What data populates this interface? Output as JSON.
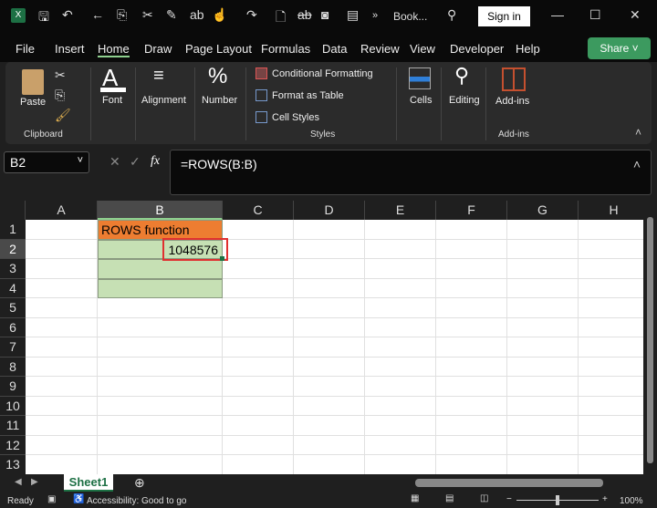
{
  "title": {
    "doc": "Book...",
    "sign_in": "Sign in",
    "more": "»"
  },
  "menu": [
    "File",
    "Insert",
    "Home",
    "Draw",
    "Page Layout",
    "Formulas",
    "Data",
    "Review",
    "View",
    "Developer",
    "Help"
  ],
  "share": "Share",
  "ribbon": {
    "paste": "Paste",
    "clipboard": "Clipboard",
    "font": "Font",
    "alignment": "Alignment",
    "number": "Number",
    "conditional": "Conditional Formatting",
    "format_table": "Format as Table",
    "cell_styles": "Cell Styles",
    "styles": "Styles",
    "cells": "Cells",
    "editing": "Editing",
    "addins": "Add-ins",
    "addins_group": "Add-ins"
  },
  "formula_bar": {
    "name_box": "B2",
    "fx": "fx",
    "formula": "=ROWS(B:B)"
  },
  "columns": [
    "A",
    "B",
    "C",
    "D",
    "E",
    "F",
    "G",
    "H"
  ],
  "rows": [
    "1",
    "2",
    "3",
    "4",
    "5",
    "6",
    "7",
    "8",
    "9",
    "10",
    "11",
    "12",
    "13"
  ],
  "cells": {
    "B1": "ROWS function",
    "B2": "1048576"
  },
  "colors": {
    "header_fill": "#ed7d31",
    "data_fill": "#c6e0b4",
    "highlight": "#e03030",
    "accent": "#3c9a5f"
  },
  "sheet_tab": "Sheet1",
  "status": {
    "ready": "Ready",
    "accessibility": "Accessibility: Good to go",
    "zoom": "100%"
  }
}
